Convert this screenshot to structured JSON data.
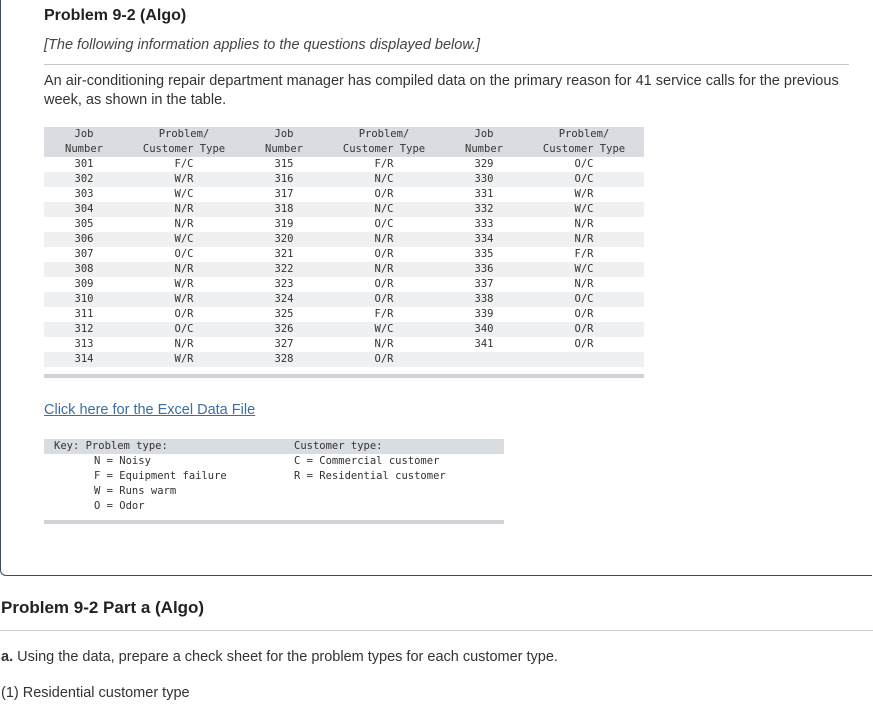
{
  "problem": {
    "title": "Problem 9-2 (Algo)",
    "info": "[The following information applies to the questions displayed below.]",
    "description": "An air-conditioning repair department manager has compiled data on the primary reason for 41 service calls for the previous week, as shown in the table."
  },
  "table": {
    "headers": [
      [
        "Job",
        "Number"
      ],
      [
        "Problem/",
        "Customer Type"
      ],
      [
        "Job",
        "Number"
      ],
      [
        "Problem/",
        "Customer Type"
      ],
      [
        "Job",
        "Number"
      ],
      [
        "Problem/",
        "Customer Type"
      ]
    ],
    "rows": [
      [
        "301",
        "F/C",
        "315",
        "F/R",
        "329",
        "O/C"
      ],
      [
        "302",
        "W/R",
        "316",
        "N/C",
        "330",
        "O/C"
      ],
      [
        "303",
        "W/C",
        "317",
        "O/R",
        "331",
        "W/R"
      ],
      [
        "304",
        "N/R",
        "318",
        "N/C",
        "332",
        "W/C"
      ],
      [
        "305",
        "N/R",
        "319",
        "O/C",
        "333",
        "N/R"
      ],
      [
        "306",
        "W/C",
        "320",
        "N/R",
        "334",
        "N/R"
      ],
      [
        "307",
        "O/C",
        "321",
        "O/R",
        "335",
        "F/R"
      ],
      [
        "308",
        "N/R",
        "322",
        "N/R",
        "336",
        "W/C"
      ],
      [
        "309",
        "W/R",
        "323",
        "O/R",
        "337",
        "N/R"
      ],
      [
        "310",
        "W/R",
        "324",
        "O/R",
        "338",
        "O/C"
      ],
      [
        "311",
        "O/R",
        "325",
        "F/R",
        "339",
        "O/R"
      ],
      [
        "312",
        "O/C",
        "326",
        "W/C",
        "340",
        "O/R"
      ],
      [
        "313",
        "N/R",
        "327",
        "N/R",
        "341",
        "O/R"
      ],
      [
        "314",
        "W/R",
        "328",
        "O/R",
        "",
        ""
      ]
    ]
  },
  "link": {
    "excel": "Click here for the Excel Data File"
  },
  "key": {
    "left_header": "Key: Problem type:",
    "right_header": "Customer type:",
    "problem_types": [
      "N = Noisy",
      "F = Equipment failure",
      "W = Runs warm",
      "O = Odor"
    ],
    "customer_types": [
      "C = Commercial customer",
      "R = Residential customer"
    ]
  },
  "part_a": {
    "title": "Problem 9-2 Part a (Algo)",
    "label": "a.",
    "question": " Using the data, prepare a check sheet for the problem types for each customer type.",
    "sub": "(1) Residential customer type"
  },
  "colors": {
    "link": "#3a6fa6",
    "table_header": "#d9dde2",
    "row_alt": "#eef0f2"
  }
}
